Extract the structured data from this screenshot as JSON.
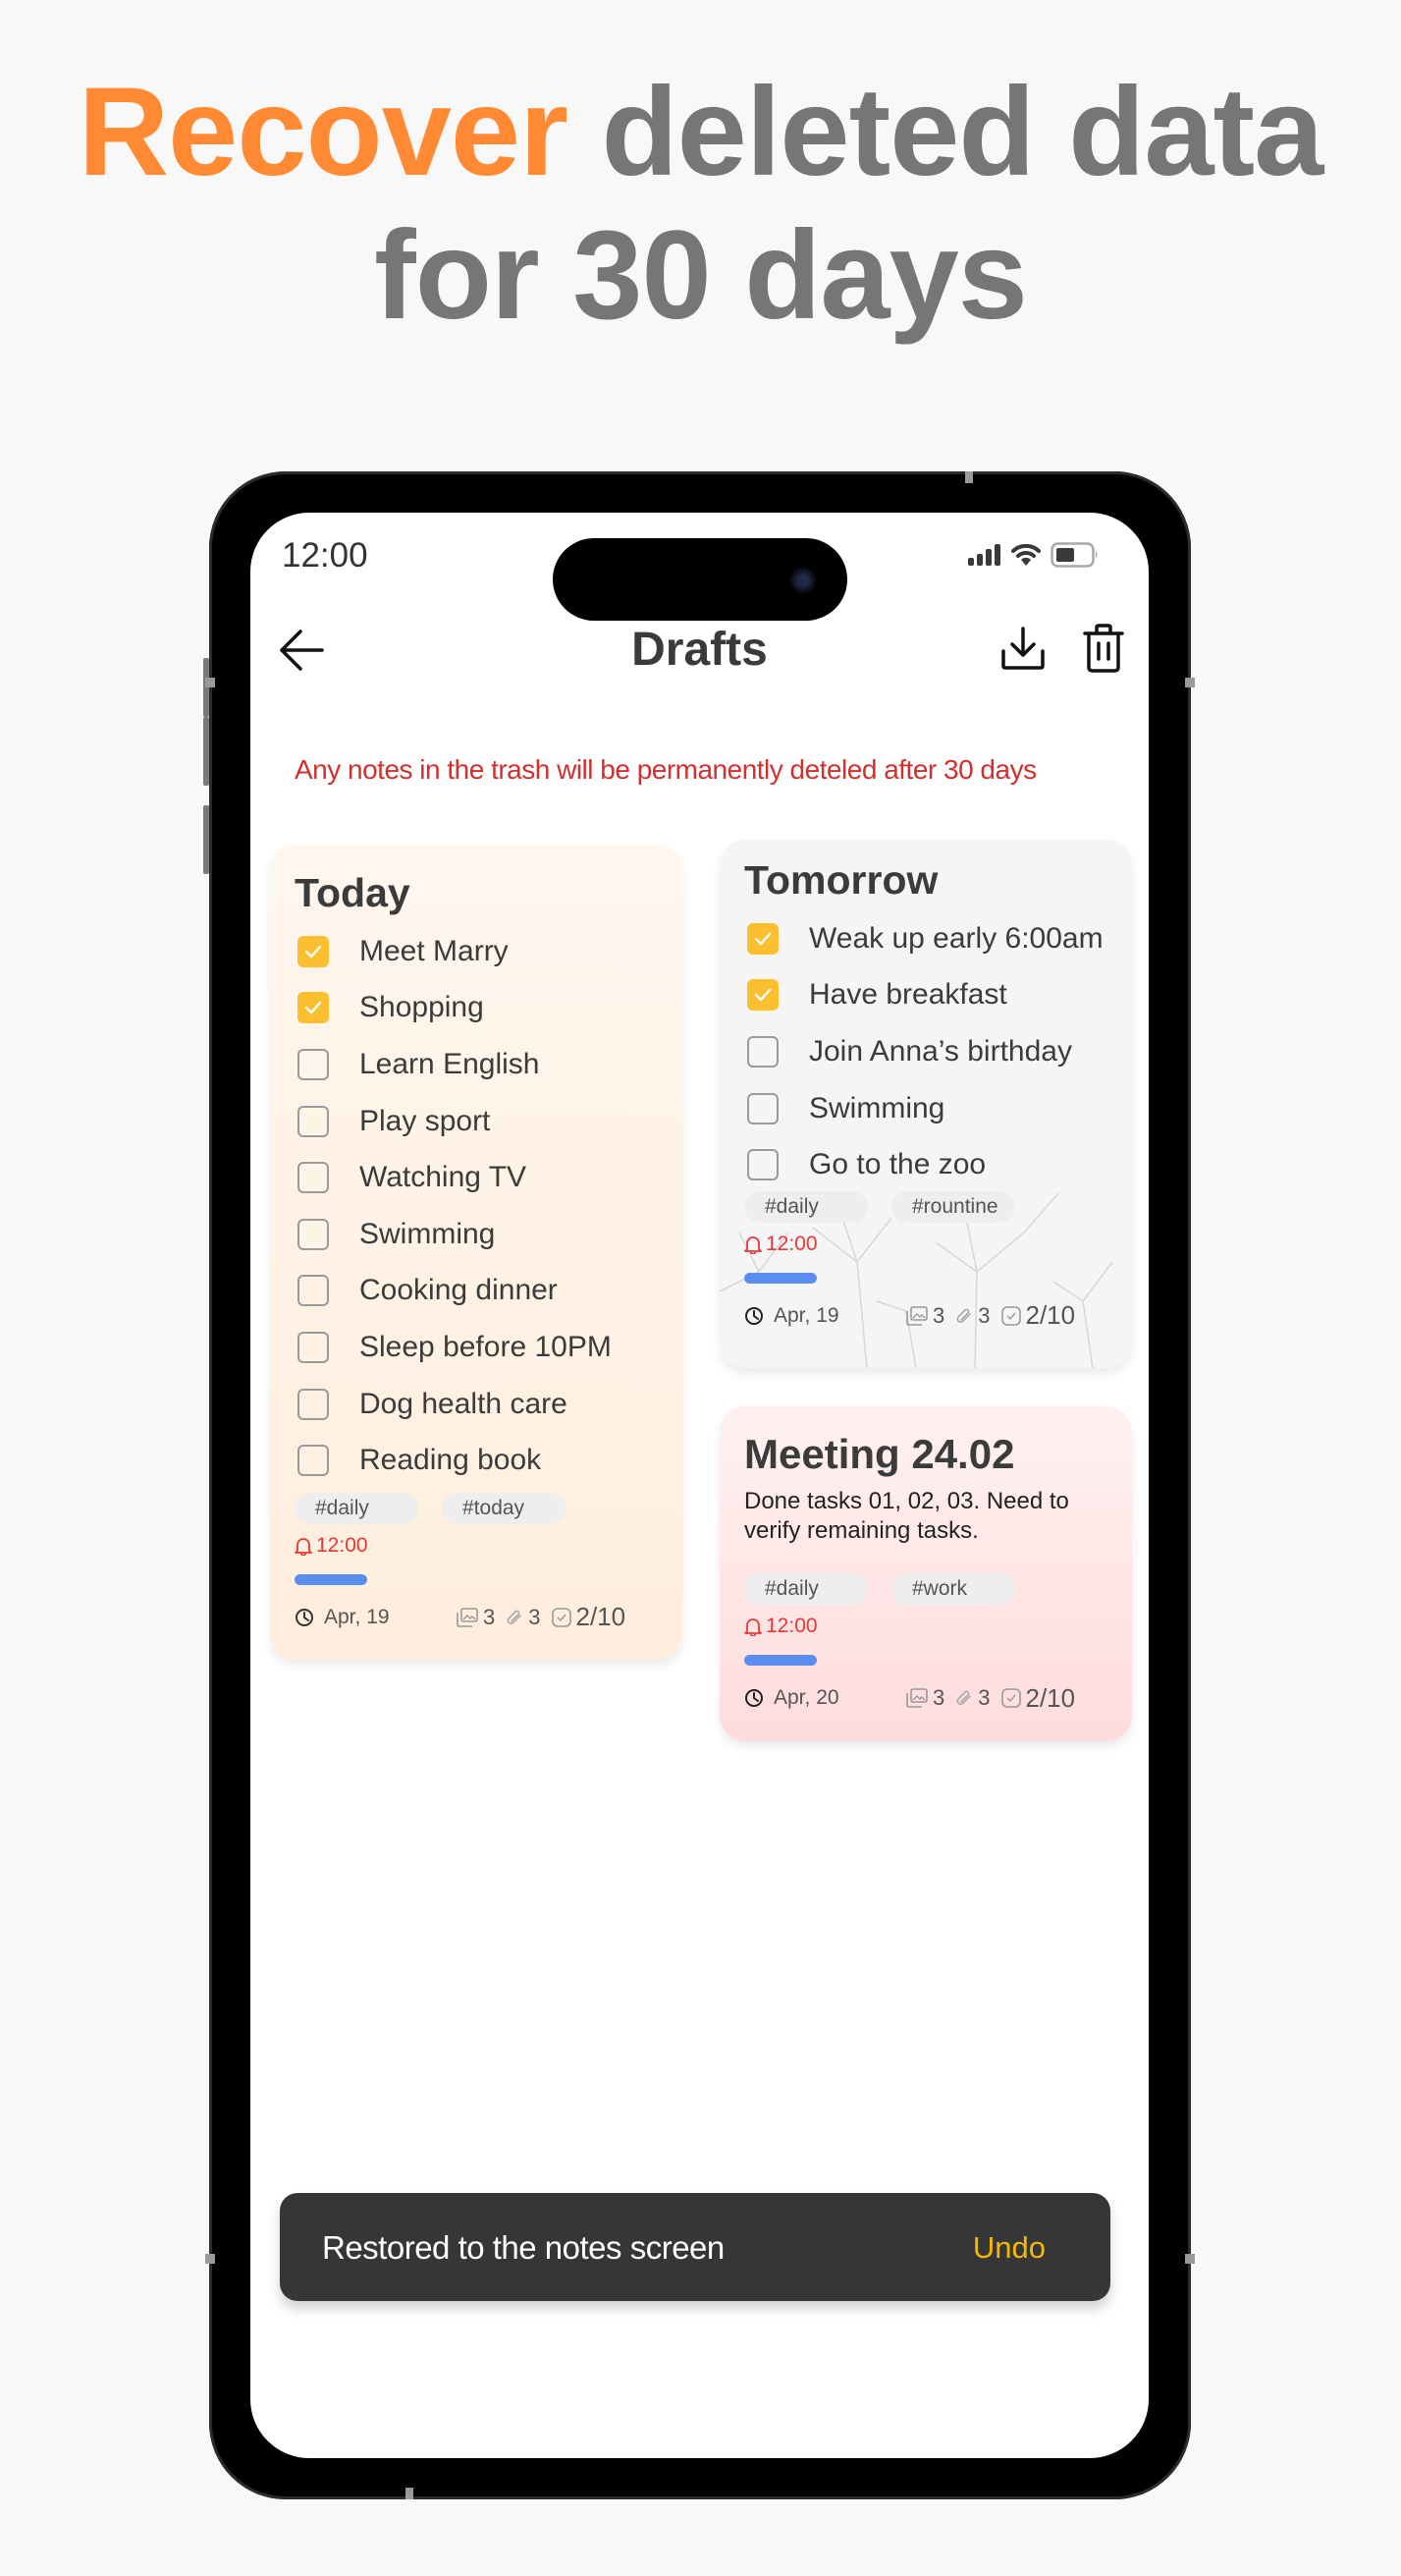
{
  "headline": {
    "accent": "Recover",
    "rest_line1": " deleted data",
    "line2": "for 30 days"
  },
  "colors": {
    "accent": "#FF8A33",
    "headline_gray": "#767676",
    "warning_red": "#D32F2F",
    "checkbox_on": "#FBBF2F",
    "progress_blue": "#5B8DEF",
    "toast_bg": "#353637",
    "undo_yellow": "#F5B800"
  },
  "status_bar": {
    "time": "12:00",
    "icons": [
      "signal-icon",
      "wifi-icon",
      "battery-icon"
    ]
  },
  "nav": {
    "title": "Drafts",
    "back_icon": "arrow-left-icon",
    "actions": [
      "download-icon",
      "trash-icon"
    ]
  },
  "warning": "Any notes in the trash will be permanently deteled after 30 days",
  "notes": [
    {
      "title": "Today",
      "items": [
        {
          "label": "Meet Marry",
          "checked": true
        },
        {
          "label": "Shopping",
          "checked": true
        },
        {
          "label": "Learn English",
          "checked": false
        },
        {
          "label": "Play sport",
          "checked": false
        },
        {
          "label": "Watching TV",
          "checked": false
        },
        {
          "label": "Swimming",
          "checked": false
        },
        {
          "label": "Cooking dinner",
          "checked": false
        },
        {
          "label": "Sleep before 10PM",
          "checked": false
        },
        {
          "label": "Dog health care",
          "checked": false
        },
        {
          "label": "Reading book",
          "checked": false
        }
      ],
      "tags": [
        "#daily",
        "#today"
      ],
      "alarm": "12:00",
      "progress": 0.2,
      "date": "Apr, 19",
      "images": "3",
      "attachments": "3",
      "tasks": "2/10"
    },
    {
      "title": "Tomorrow",
      "items": [
        {
          "label": "Weak up early 6:00am",
          "checked": true
        },
        {
          "label": "Have breakfast",
          "checked": true
        },
        {
          "label": "Join Anna’s birthday",
          "checked": false
        },
        {
          "label": "Swimming",
          "checked": false
        },
        {
          "label": "Go to the zoo",
          "checked": false
        }
      ],
      "tags": [
        "#daily",
        "#rountine"
      ],
      "alarm": "12:00",
      "progress": 0.2,
      "date": "Apr, 19",
      "images": "3",
      "attachments": "3",
      "tasks": "2/10"
    },
    {
      "title": "Meeting 24.02",
      "body": "Done tasks 01, 02, 03. Need to verify remaining tasks.",
      "tags": [
        "#daily",
        "#work"
      ],
      "alarm": "12:00",
      "progress": 0.2,
      "date": "Apr, 20",
      "images": "3",
      "attachments": "3",
      "tasks": "2/10"
    }
  ],
  "toast": {
    "message": "Restored to the notes screen",
    "action": "Undo"
  }
}
